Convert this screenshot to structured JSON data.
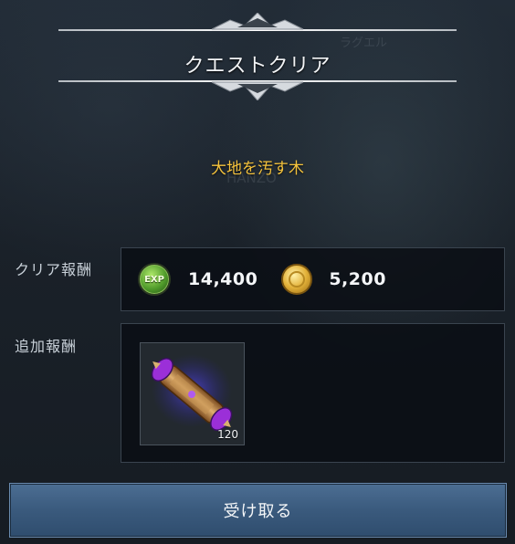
{
  "dialog": {
    "title": "クエストクリア",
    "quest_name": "大地を汚す木"
  },
  "clear_reward": {
    "label": "クリア報酬",
    "exp_icon_text": "EXP",
    "exp_value": "14,400",
    "gold_value": "5,200"
  },
  "additional_reward": {
    "label": "追加報酬",
    "items": [
      {
        "icon": "purple-scroll-icon",
        "count": "120"
      }
    ]
  },
  "actions": {
    "receive_label": "受け取る"
  },
  "colors": {
    "quest_name": "#f4c23c",
    "button": "#3a5a7d",
    "exp_icon": "#4f9a2a",
    "gold_icon": "#e3b23a"
  }
}
